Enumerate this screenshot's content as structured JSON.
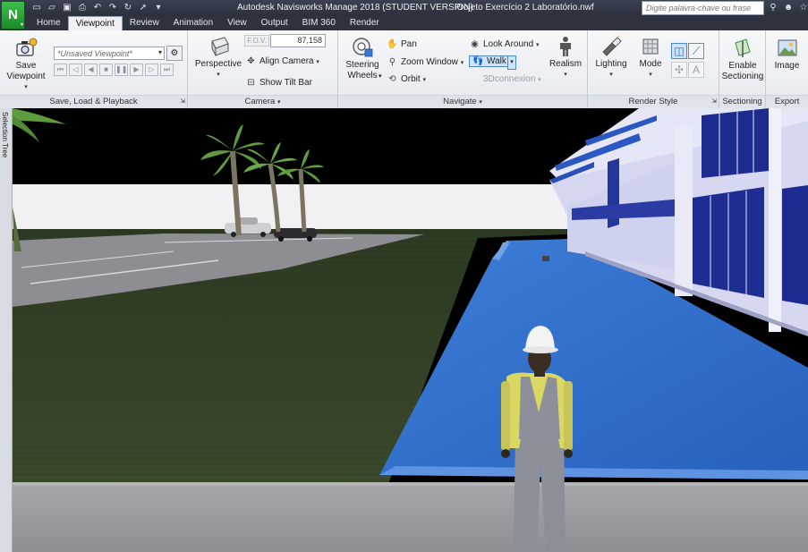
{
  "titlebar": {
    "app_logo": "N",
    "title": "Autodesk Navisworks Manage 2018 (STUDENT VERSION)",
    "file": "Projeto Exercício 2 Laboratório.nwf",
    "search_placeholder": "Digite palavra-chave ou frase"
  },
  "tabs": [
    "Home",
    "Viewpoint",
    "Review",
    "Animation",
    "View",
    "Output",
    "BIM 360",
    "Render"
  ],
  "active_tab": "Viewpoint",
  "ribbon": {
    "save_load": {
      "save_viewpoint": [
        "Save",
        "Viewpoint"
      ],
      "viewpoint_dropdown": "*Unsaved Viewpoint*",
      "title": "Save, Load & Playback"
    },
    "camera": {
      "perspective": "Perspective",
      "fov_label": "F.O.V.",
      "fov_value": "87,158",
      "align_camera": "Align Camera",
      "show_tilt_bar": "Show Tilt Bar",
      "title": "Camera"
    },
    "navigate": {
      "steering_wheels": [
        "Steering",
        "Wheels"
      ],
      "pan": "Pan",
      "zoom_window": "Zoom Window",
      "orbit": "Orbit",
      "look_around": "Look Around",
      "walk": "Walk",
      "connexion": "3Dconnexion",
      "realism": "Realism",
      "title": "Navigate"
    },
    "render_style": {
      "lighting": "Lighting",
      "mode": "Mode",
      "text_tool": "A",
      "title": "Render Style"
    },
    "sectioning": {
      "enable": [
        "Enable",
        "Sectioning"
      ],
      "title": "Sectioning"
    },
    "export": {
      "image": "Image",
      "title": "Export"
    }
  },
  "sidebar": {
    "selection_tree": "Selection Tree"
  },
  "colors": {
    "titlebar": "#2d323d",
    "ribbon": "#eceef2",
    "sky": "#000000",
    "grass": "#2e3b22",
    "pool": "#2f6fcf",
    "building": "#d7d9f2",
    "glass": "#1b2a8c"
  }
}
